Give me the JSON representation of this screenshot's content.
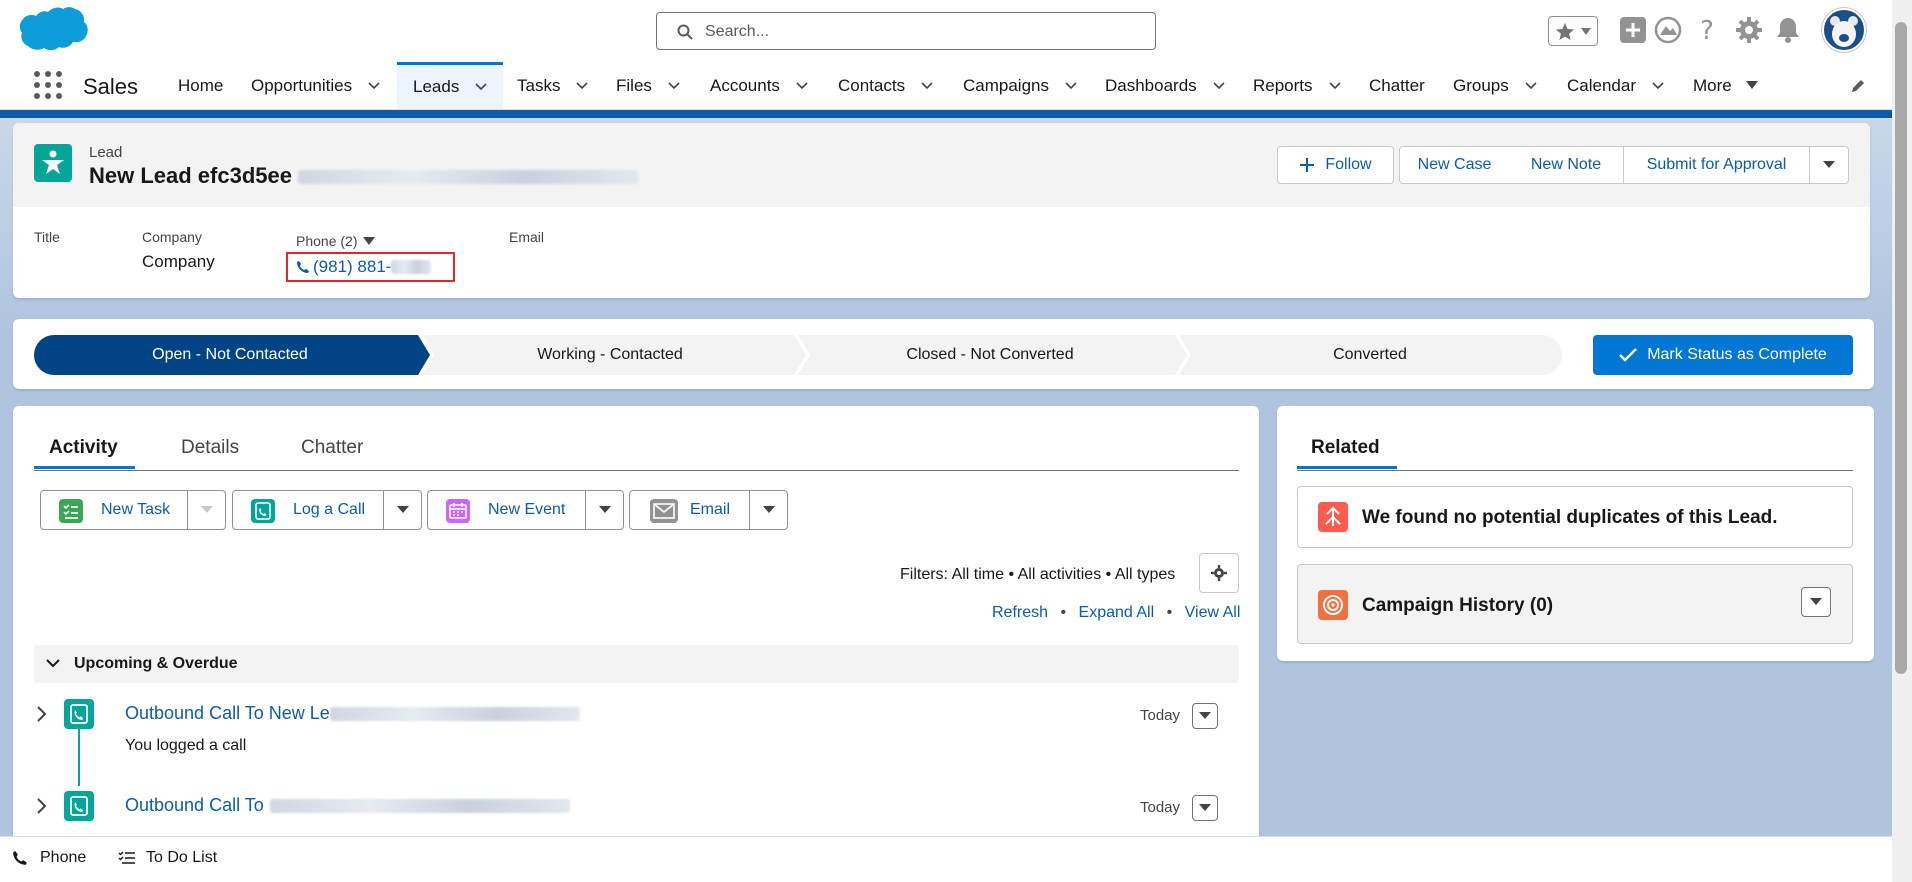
{
  "header": {
    "search_placeholder": "Search..."
  },
  "nav": {
    "app_name": "Sales",
    "items": [
      {
        "label": "Home",
        "has_menu": false
      },
      {
        "label": "Opportunities",
        "has_menu": true
      },
      {
        "label": "Leads",
        "has_menu": true,
        "active": true
      },
      {
        "label": "Tasks",
        "has_menu": true
      },
      {
        "label": "Files",
        "has_menu": true
      },
      {
        "label": "Accounts",
        "has_menu": true
      },
      {
        "label": "Contacts",
        "has_menu": true
      },
      {
        "label": "Campaigns",
        "has_menu": true
      },
      {
        "label": "Dashboards",
        "has_menu": true
      },
      {
        "label": "Reports",
        "has_menu": true
      },
      {
        "label": "Chatter",
        "has_menu": false
      },
      {
        "label": "Groups",
        "has_menu": true
      },
      {
        "label": "Calendar",
        "has_menu": true
      },
      {
        "label": "More",
        "has_menu": true
      }
    ]
  },
  "record": {
    "object_label": "Lead",
    "title": "New Lead efc3d5ee",
    "actions": {
      "follow": "Follow",
      "new_case": "New Case",
      "new_note": "New Note",
      "submit": "Submit for Approval"
    },
    "fields": {
      "title_label": "Title",
      "company_label": "Company",
      "company_value": "Company",
      "phone_label": "Phone (2)",
      "phone_value": "(981) 881-",
      "email_label": "Email"
    }
  },
  "path": {
    "steps": [
      "Open - Not Contacted",
      "Working - Contacted",
      "Closed - Not Converted",
      "Converted"
    ],
    "current_step": 0,
    "mark_button": "Mark Status as Complete"
  },
  "activity": {
    "tabs": [
      "Activity",
      "Details",
      "Chatter"
    ],
    "buttons": {
      "new_task": "New Task",
      "log_call": "Log a Call",
      "new_event": "New Event",
      "email": "Email"
    },
    "filters": "Filters: All time • All activities • All types",
    "links": {
      "refresh": "Refresh",
      "expand_all": "Expand All",
      "view_all": "View All"
    },
    "section_title": "Upcoming & Overdue",
    "items": [
      {
        "title": "Outbound Call To New Le",
        "date": "Today",
        "subtitle": "You logged a call"
      },
      {
        "title": "Outbound Call To",
        "date": "Today",
        "subtitle": ""
      }
    ]
  },
  "related": {
    "tab": "Related",
    "duplicates": "We found no potential duplicates of this Lead.",
    "campaign_history": "Campaign History (0)"
  },
  "utility_bar": {
    "phone": "Phone",
    "todo": "To Do List"
  },
  "colors": {
    "brand": "#0176d3",
    "link": "#0b5cab",
    "path_active": "#014486",
    "lead_icon": "#06a59a"
  }
}
